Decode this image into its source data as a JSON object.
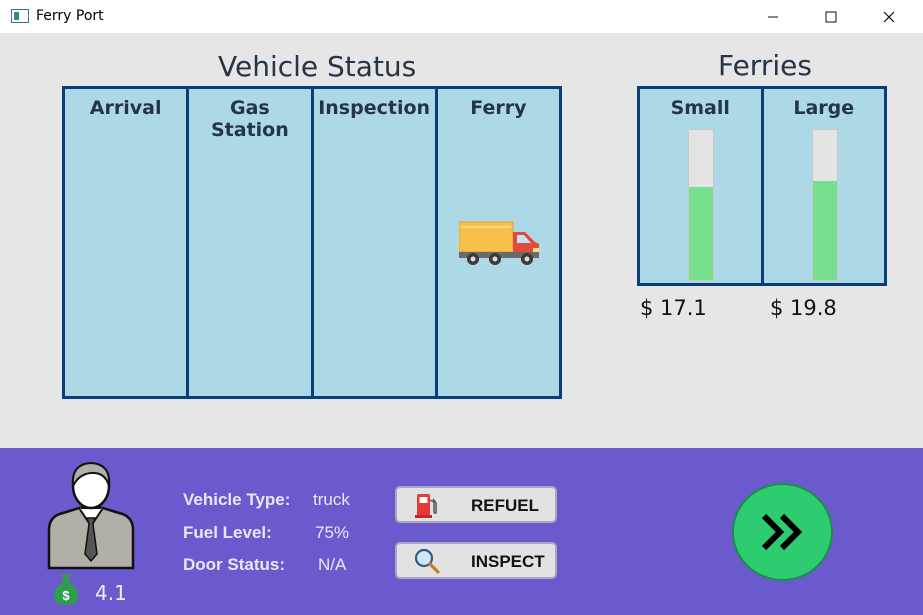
{
  "window": {
    "title": "Ferry Port",
    "controls": [
      "minimize-icon",
      "maximize-icon",
      "close-icon"
    ]
  },
  "vehicle_status": {
    "heading": "Vehicle Status",
    "columns": [
      "Arrival",
      "Gas Station",
      "Inspection",
      "Ferry"
    ],
    "vehicle_in_column": "Ferry",
    "vehicle_icon": "truck-icon"
  },
  "ferries": {
    "heading": "Ferries",
    "columns": [
      {
        "label": "Small",
        "fill_fraction": 0.62,
        "price": "$ 17.1"
      },
      {
        "label": "Large",
        "fill_fraction": 0.66,
        "price": "$ 19.8"
      }
    ],
    "fill_color": "#77df8e"
  },
  "player": {
    "avatar_icon": "person-icon",
    "money_icon": "money-bag-icon",
    "money": "4.1"
  },
  "vehicle_info": {
    "type_label": "Vehicle Type:",
    "type_value": "truck",
    "fuel_label": "Fuel Level:",
    "fuel_value": "75%",
    "door_label": "Door Status:",
    "door_value": "N/A"
  },
  "actions": {
    "refuel_label": "REFUEL",
    "refuel_icon": "fuel-pump-icon",
    "inspect_label": "INSPECT",
    "inspect_icon": "magnifier-icon",
    "next_icon": "fast-forward-icon"
  },
  "colors": {
    "panel_bg": "#add8e6",
    "panel_border": "#0a3d7a",
    "bottom_bg": "#6a5acd",
    "next_button": "#2ecc71"
  }
}
